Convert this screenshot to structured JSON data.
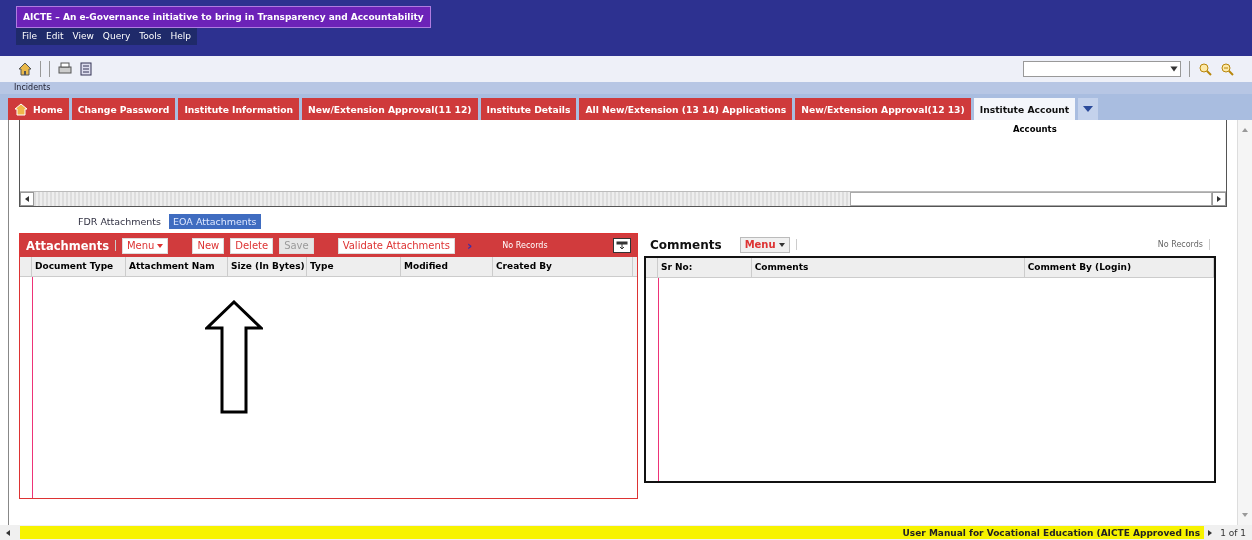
{
  "window": {
    "title": "AICTE – An e-Governance initiative to bring in Transparency and Accountability"
  },
  "menu": [
    "File",
    "Edit",
    "View",
    "Query",
    "Tools",
    "Help"
  ],
  "breadcrumb": "Incidents",
  "tabs": [
    {
      "label": "Home",
      "kind": "home",
      "selected": false
    },
    {
      "label": "Change Password",
      "kind": "text",
      "selected": false
    },
    {
      "label": "Institute Information",
      "kind": "text",
      "selected": false
    },
    {
      "label": "New/Extension Approval(11 12)",
      "kind": "text",
      "selected": false
    },
    {
      "label": "Institute Details",
      "kind": "text",
      "selected": false
    },
    {
      "label": "All New/Extension (13 14) Applications",
      "kind": "text",
      "selected": false
    },
    {
      "label": "New/Extension Approval(12 13)",
      "kind": "text",
      "selected": false
    },
    {
      "label": "Institute Account",
      "kind": "text",
      "selected": true
    }
  ],
  "section_label": "Accounts",
  "sub_tabs": [
    {
      "label": "FDR Attachments",
      "selected": false
    },
    {
      "label": "EOA Attachments",
      "selected": true
    }
  ],
  "attachments": {
    "title": "Attachments",
    "menu": "Menu",
    "buttons": [
      {
        "label": "New",
        "disabled": false
      },
      {
        "label": "Delete",
        "disabled": false
      },
      {
        "label": "Save",
        "disabled": true
      },
      {
        "label": "Validate Attachments",
        "disabled": false
      }
    ],
    "next": "›",
    "records": "No Records",
    "columns": [
      "Document Type",
      "Attachment Nam",
      "Size (In Bytes)",
      "Type",
      "Modified",
      "Created By"
    ]
  },
  "comments": {
    "title": "Comments",
    "menu": "Menu",
    "records": "No Records",
    "columns": [
      "Sr No:",
      "Comments",
      "Comment By (Login)"
    ]
  },
  "status_bar": {
    "text": "User Manual for Vocational Education (AICTE Approved Ins",
    "page": "1 of 1"
  }
}
